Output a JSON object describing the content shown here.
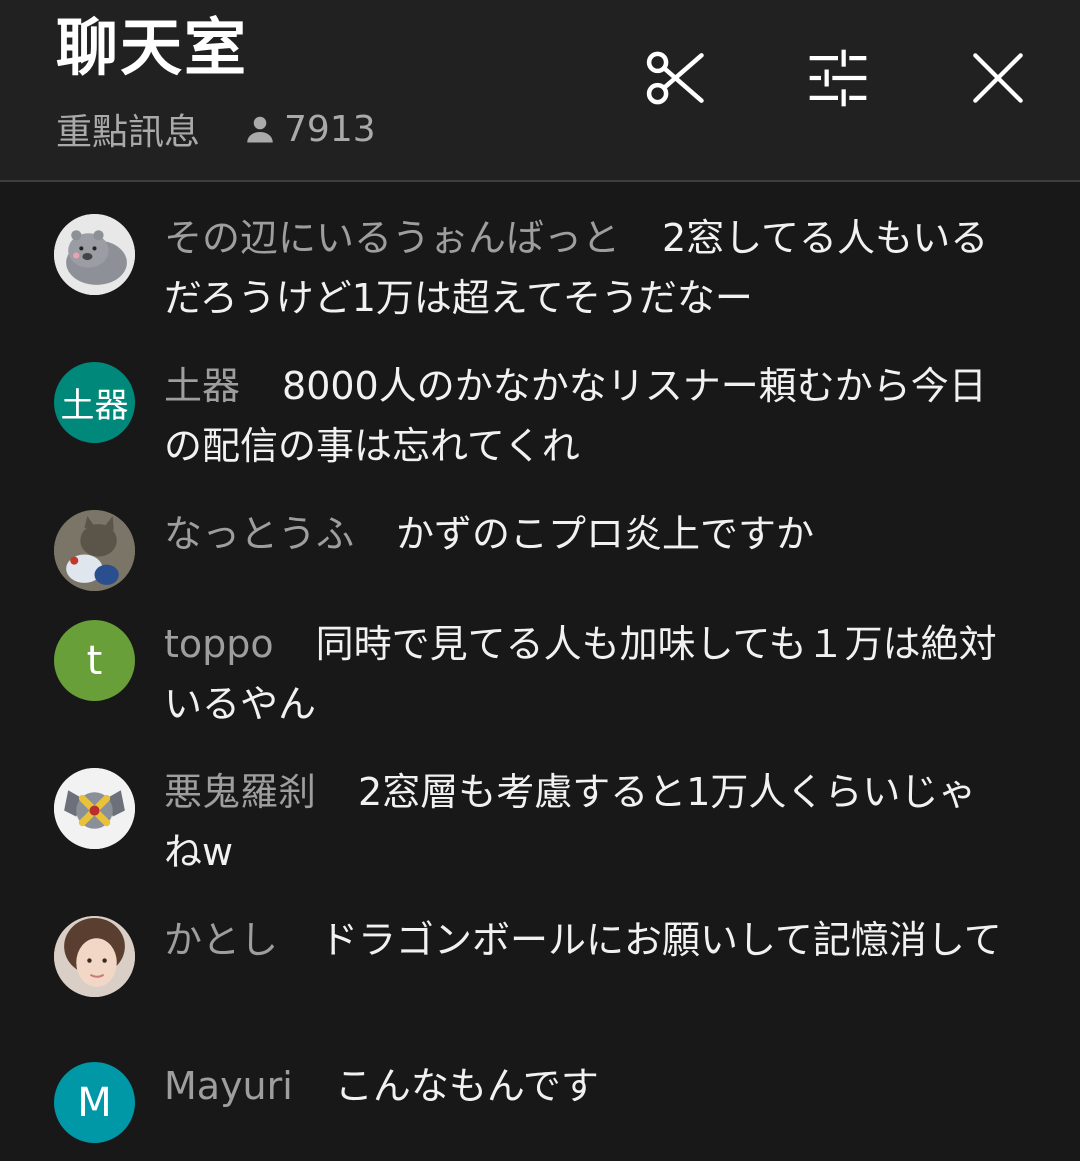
{
  "header": {
    "title": "聊天室",
    "mode_label": "重點訊息",
    "viewer_count": "7913",
    "icons": [
      "clip-icon",
      "filter-sliders-icon",
      "close-icon"
    ]
  },
  "messages": [
    {
      "author": "その辺にいるうぉんばっと",
      "text": "2窓してる人もいるだろうけど1万は超えてそうだなー",
      "avatar_text": "",
      "avatar_color": "#e6e6e6"
    },
    {
      "author": "土器",
      "text": "8000人のかなかなリスナー頼むから今日の配信の事は忘れてくれ",
      "avatar_text": "土器",
      "avatar_color": "#00897b"
    },
    {
      "author": "なっとうふ",
      "text": "かずのこプロ炎上ですか",
      "avatar_text": "",
      "avatar_color": "#6b6a5e"
    },
    {
      "author": "toppo",
      "text": "同時で見てる人も加味しても１万は絶対いるやん",
      "avatar_text": "t",
      "avatar_color": "#689f38"
    },
    {
      "author": "悪鬼羅刹",
      "text": "2窓層も考慮すると1万人くらいじゃねw",
      "avatar_text": "",
      "avatar_color": "#f2f2f2"
    },
    {
      "author": "かとし",
      "text": "ドラゴンボールにお願いして記憶消して",
      "avatar_text": "",
      "avatar_color": "#c9b7a8"
    },
    {
      "author": "Mayuri",
      "text": "こんなもんです",
      "avatar_text": "M",
      "avatar_color": "#0097a7"
    }
  ]
}
